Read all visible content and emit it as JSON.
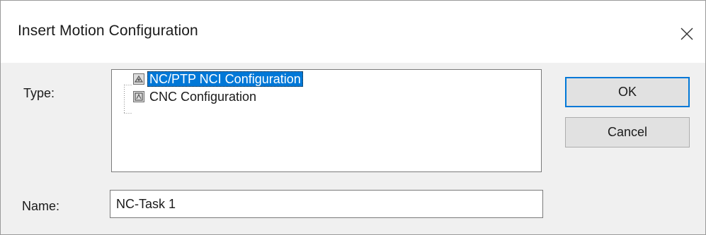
{
  "dialog": {
    "title": "Insert Motion Configuration",
    "close_icon": "close-icon"
  },
  "form": {
    "type_label": "Type:",
    "name_label": "Name:",
    "name_value": "NC-Task 1"
  },
  "tree": {
    "items": [
      {
        "label": "NC/PTP NCI Configuration",
        "icon": "nc-ptp-config-icon",
        "selected": true
      },
      {
        "label": "CNC Configuration",
        "icon": "cnc-config-icon",
        "selected": false
      }
    ]
  },
  "buttons": {
    "ok_label": "OK",
    "cancel_label": "Cancel"
  },
  "colors": {
    "selection": "#0078d7",
    "dialog_bg": "#f0f0f0",
    "title_bg": "#ffffff"
  }
}
